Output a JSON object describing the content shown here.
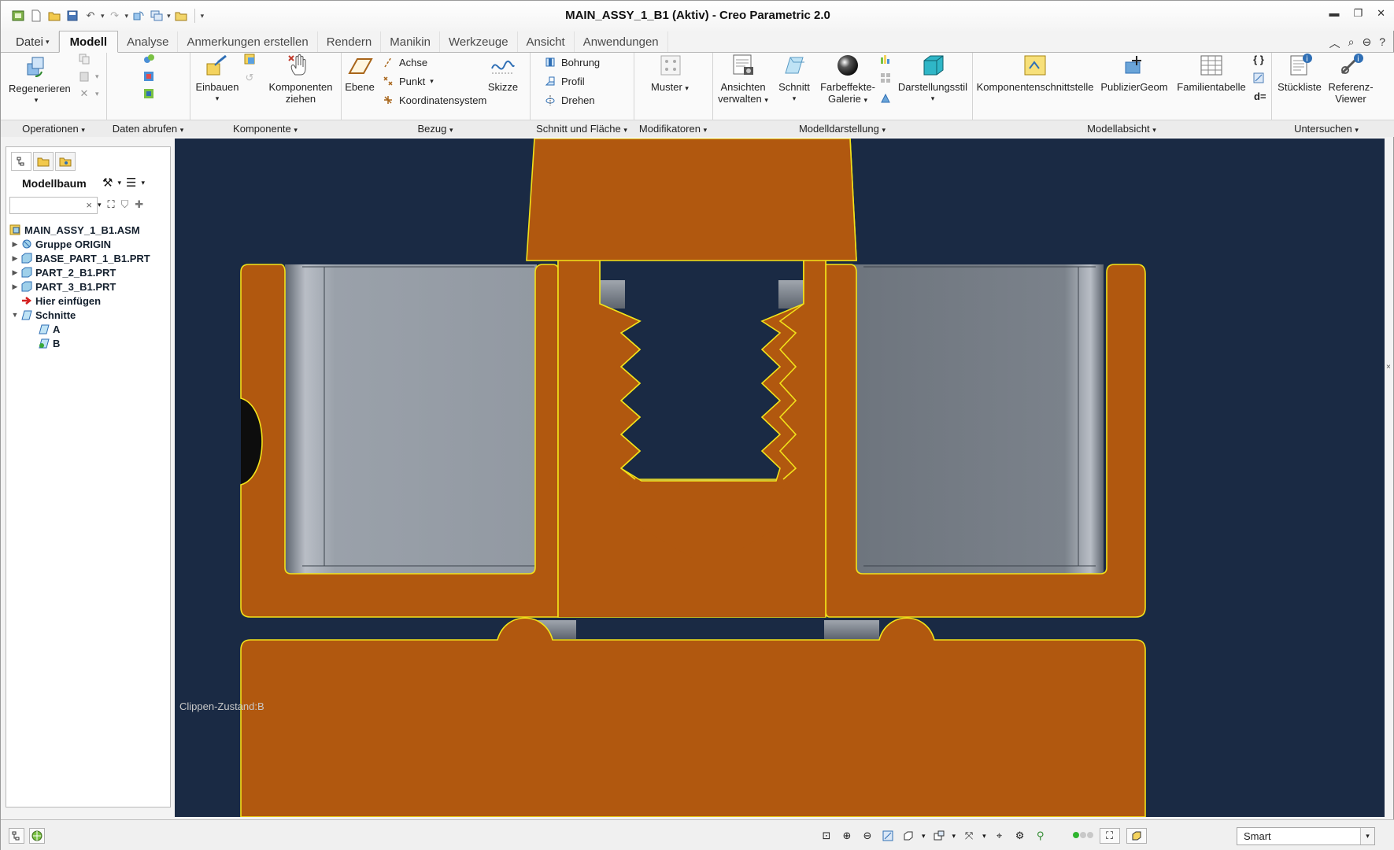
{
  "window": {
    "title": "MAIN_ASSY_1_B1 (Aktiv) - Creo Parametric 2.0"
  },
  "tabs": [
    {
      "label": "Datei"
    },
    {
      "label": "Modell"
    },
    {
      "label": "Analyse"
    },
    {
      "label": "Anmerkungen erstellen"
    },
    {
      "label": "Rendern"
    },
    {
      "label": "Manikin"
    },
    {
      "label": "Werkzeuge"
    },
    {
      "label": "Ansicht"
    },
    {
      "label": "Anwendungen"
    }
  ],
  "active_tab": "Modell",
  "ribbon": {
    "regenerate": "Regenerieren",
    "einbauen": "Einbauen",
    "komponenten_line1": "Komponenten",
    "komponenten_line2": "ziehen",
    "ebene": "Ebene",
    "achse": "Achse",
    "punkt": "Punkt",
    "koordinatensystem": "Koordinatensystem",
    "skizze": "Skizze",
    "bohrung": "Bohrung",
    "profil": "Profil",
    "drehen": "Drehen",
    "muster": "Muster",
    "ansichten_line1": "Ansichten",
    "ansichten_line2": "verwalten",
    "schnitt": "Schnitt",
    "farbeffekte_line1": "Farbeffekte-",
    "farbeffekte_line2": "Galerie",
    "darstellungsstil": "Darstellungsstil",
    "komponentenschnittstelle": "Komponentenschnittstelle",
    "publiziergeom": "PublizierGeom",
    "familientabelle": "Familientabelle",
    "stueckliste": "Stückliste",
    "referenz_line1": "Referenz-",
    "referenz_line2": "Viewer",
    "relations_icon_text": "d="
  },
  "groups": [
    {
      "label": "Operationen"
    },
    {
      "label": "Daten abrufen"
    },
    {
      "label": "Komponente"
    },
    {
      "label": "Bezug"
    },
    {
      "label": "Schnitt und Fläche"
    },
    {
      "label": "Modifikatoren"
    },
    {
      "label": "Modelldarstellung"
    },
    {
      "label": "Modellabsicht"
    },
    {
      "label": "Untersuchen"
    }
  ],
  "model_tree": {
    "header": "Modellbaum",
    "search_placeholder": "",
    "items": [
      {
        "label": "MAIN_ASSY_1_B1.ASM"
      },
      {
        "label": "Gruppe ORIGIN"
      },
      {
        "label": "BASE_PART_1_B1.PRT"
      },
      {
        "label": "PART_2_B1.PRT"
      },
      {
        "label": "PART_3_B1.PRT"
      },
      {
        "label": "Hier einfügen"
      },
      {
        "label": "Schnitte"
      },
      {
        "label": "A"
      },
      {
        "label": "B"
      }
    ]
  },
  "viewport": {
    "clip_state": "Clippen-Zustand:B",
    "colors": {
      "background": "#1a2a44",
      "section_fill": "#b1580f",
      "section_edge": "#f2e21a",
      "gray_face": "#8c939c"
    }
  },
  "statusbar": {
    "filter_value": "Smart"
  }
}
